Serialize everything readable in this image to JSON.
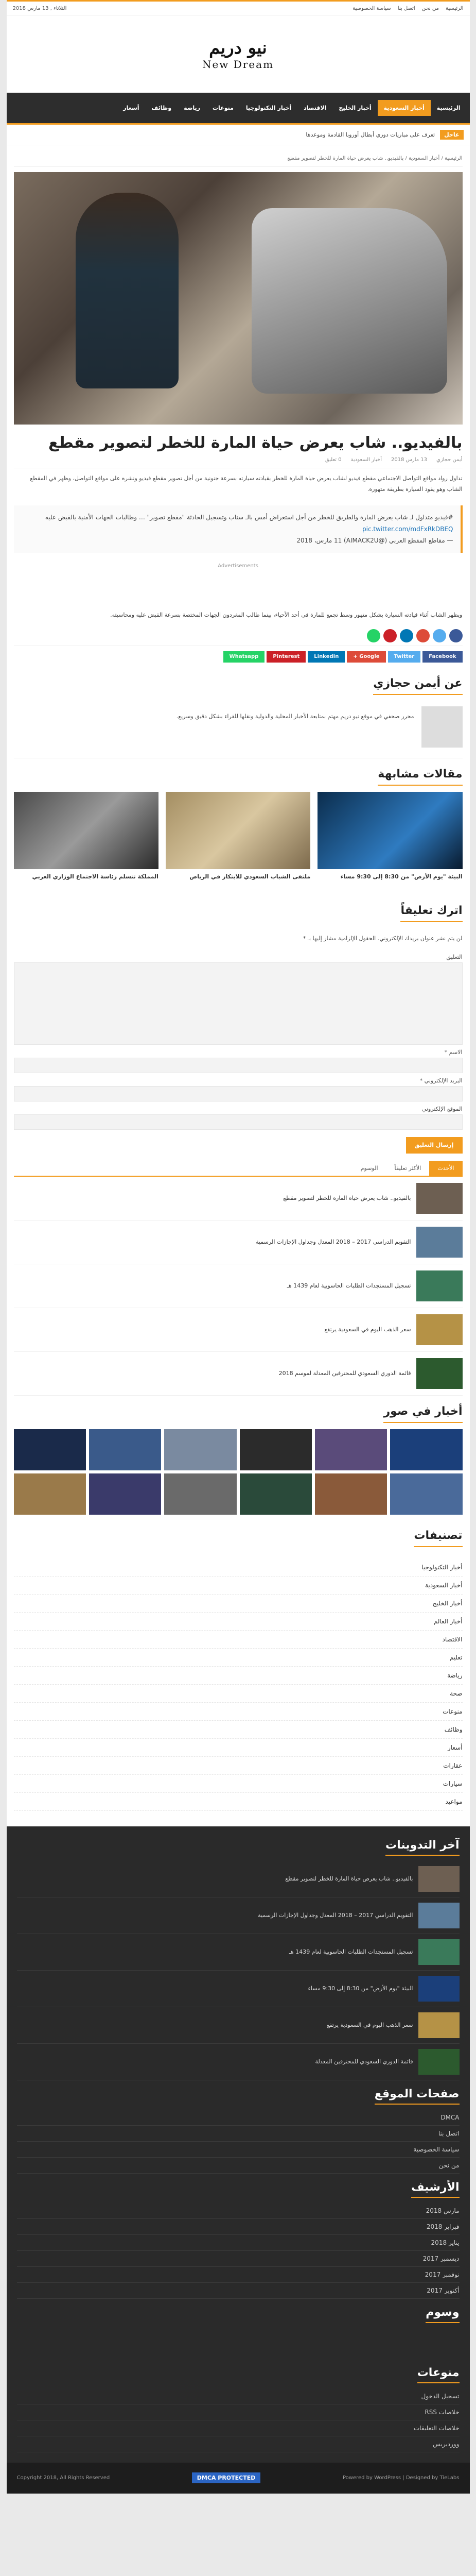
{
  "topbar": {
    "links": [
      "الرئيسية",
      "من نحن",
      "اتصل بنا",
      "سياسة الخصوصية"
    ],
    "date": "الثلاثاء , 13 مارس 2018"
  },
  "logo": {
    "ar": "نيو دريم",
    "en": "New Dream"
  },
  "nav": [
    "الرئيسية",
    "أخبار السعودية",
    "أخبار الخليج",
    "الاقتصاد",
    "أخبار التكنولوجيا",
    "منوعات",
    "رياضة",
    "وظائف",
    "أسعار"
  ],
  "ticker": {
    "label": "عاجل",
    "text": "تعرف على مباريات دوري أبطال أوروبا القادمة وموعدها"
  },
  "breadcrumb": "الرئيسية / أخبار السعودية / بالفيديو.. شاب يعرض حياة المارة للخطر لتصوير مقطع",
  "post": {
    "title": "بالفيديو.. شاب يعرض حياة المارة للخطر لتصوير مقطع",
    "meta": [
      "أيمن حجازي",
      "13 مارس 2018",
      "أخبار السعودية",
      "0 تعليق"
    ],
    "p1": "تداول رواد مواقع التواصل الاجتماعي مقطع فيديو لشاب يعرض حياة المارة للخطر بقيادته سيارته بسرعة جنونية من أجل تصوير مقطع فيديو ونشره على مواقع التواصل، وظهر في المقطع الشاب وهو يقود السيارة بطريقة متهورة.",
    "tweet": "#فيديو متداول لـ شاب يعرض المارة والطريق للخطر من أجل استعراض أمس بالـ سناب وتسجيل الحادثة \"مقطع تصوير\" … وطالبات الجهات الأمنية بالقبض عليه",
    "tweet_link": "pic.twitter.com/mdFxRkDBEQ",
    "tweet_by": "— مقاطع المقطع العربي (@AIMACK2U) 11 مارس، 2018",
    "ad": "Advertisements",
    "p2": "ويظهر الشاب أثناء قيادته السيارة بشكل متهور وسط تجمع للمارة في أحد الأحياء، بينما طالب المغردون الجهات المختصة بسرعة القبض عليه ومحاسبته."
  },
  "share": [
    "Facebook",
    "Twitter",
    "Google +",
    "LinkedIn",
    "Pinterest",
    "Whatsapp"
  ],
  "share_colors": [
    "#3b5998",
    "#55acee",
    "#dd4b39",
    "#0077b5",
    "#cb2027",
    "#25d366"
  ],
  "author": {
    "title": "عن أيمن حجازي",
    "bio": "محرر صحفي في موقع نيو دريم مهتم بمتابعة الأخبار المحلية والدولية ونقلها للقراء بشكل دقيق وسريع."
  },
  "related_title": "مقالات مشابهة",
  "related": [
    "البيئة \"يوم الأرض\" من 8:30 إلى 9:30 مساء",
    "ملتقى الشباب السعودي للابتكار في الرياض",
    "المملكة تتسلم رئاسة الاجتماع الوزاري العربي"
  ],
  "comment": {
    "title": "اترك تعليقاً",
    "note": "لن يتم نشر عنوان بريدك الإلكتروني. الحقول الإلزامية مشار إليها بـ *",
    "fields": [
      "التعليق",
      "الاسم *",
      "البريد الإلكتروني *",
      "الموقع الإلكتروني"
    ],
    "submit": "إرسال التعليق"
  },
  "tabs": [
    "الأحدث",
    "الأكثر تعليقاً",
    "الوسوم"
  ],
  "list": [
    "بالفيديو.. شاب يعرض حياة المارة للخطر لتصوير مقطع",
    "التقويم الدراسي 2017 – 2018 المعدل وجداول الإجازات الرسمية",
    "تسجيل المستجدات الطلبات الحاسوبية لعام 1439 هـ",
    "سعر الذهب اليوم في السعودية يرتفع",
    "قائمة الدوري السعودي للمحترفين المعدلة لموسم 2018"
  ],
  "gallery_title": "أخبار في صور",
  "categories_title": "تصنيفات",
  "categories": [
    "أخبار التكنولوجيا",
    "أخبار السعودية",
    "أخبار الخليج",
    "أخبار العالم",
    "الاقتصاد",
    "تعليم",
    "رياضة",
    "صحة",
    "منوعات",
    "وظائف",
    "أسعار",
    "عقارات",
    "سيارات",
    "مواعيد"
  ],
  "footer": {
    "latest_title": "آخر التدوينات",
    "latest": [
      "بالفيديو.. شاب يعرض حياة المارة للخطر لتصوير مقطع",
      "التقويم الدراسي 2017 – 2018 المعدل وجداول الإجازات الرسمية",
      "تسجيل المستجدات الطلبات الحاسوبية لعام 1439 هـ",
      "البيئة \"يوم الأرض\" من 8:30 إلى 9:30 مساء",
      "سعر الذهب اليوم في السعودية يرتفع",
      "قائمة الدوري السعودي للمحترفين المعدلة"
    ],
    "pages_title": "صفحات الموقع",
    "pages": [
      "DMCA",
      "اتصل بنا",
      "سياسة الخصوصية",
      "من نحن"
    ],
    "archive_title": "الأرشيف",
    "archive": [
      "مارس 2018",
      "فبراير 2018",
      "يناير 2018",
      "ديسمبر 2017",
      "نوفمبر 2017",
      "أكتوبر 2017"
    ],
    "tags_title": "وسوم",
    "meta_title": "منوعات",
    "meta": [
      "تسجيل الدخول",
      "خلاصات RSS",
      "خلاصات التعليقات",
      "ووردبريس"
    ]
  },
  "copy": {
    "left": "Powered by WordPress | Designed by TieLabs",
    "right": "Copyright 2018, All Rights Reserved",
    "dmca": "DMCA PROTECTED"
  }
}
